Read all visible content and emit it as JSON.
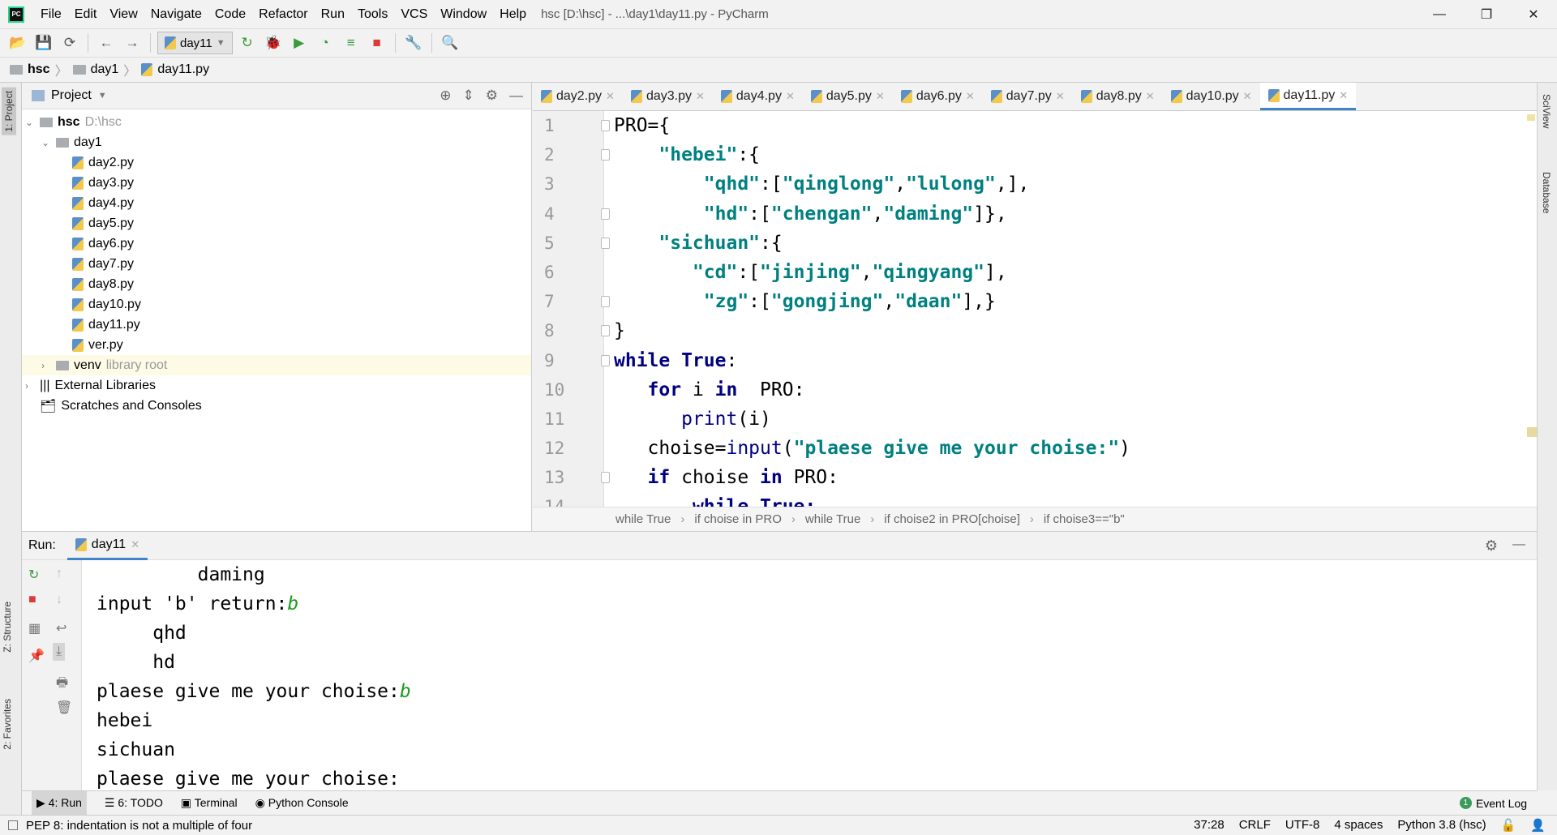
{
  "window": {
    "title": "hsc [D:\\hsc] - ...\\day1\\day11.py - PyCharm",
    "minimize": "—",
    "restore": "❐",
    "close": "✕"
  },
  "menu": [
    "File",
    "Edit",
    "View",
    "Navigate",
    "Code",
    "Refactor",
    "Run",
    "Tools",
    "VCS",
    "Window",
    "Help"
  ],
  "toolbar": {
    "run_config": "day11"
  },
  "navbar": [
    "hsc",
    "day1",
    "day11.py"
  ],
  "left_stripe": {
    "project": "1: Project",
    "structure": "Z: Structure",
    "favorites": "2: Favorites"
  },
  "right_stripe": {
    "sciview": "SciView",
    "database": "Database"
  },
  "project": {
    "title": "Project",
    "root": {
      "name": "hsc",
      "path": "D:\\hsc"
    },
    "folder": "day1",
    "files": [
      "day2.py",
      "day3.py",
      "day4.py",
      "day5.py",
      "day6.py",
      "day7.py",
      "day8.py",
      "day10.py",
      "day11.py",
      "ver.py"
    ],
    "venv": {
      "name": "venv",
      "note": "library root"
    },
    "external": "External Libraries",
    "scratches": "Scratches and Consoles"
  },
  "editor": {
    "tabs": [
      "day2.py",
      "day3.py",
      "day4.py",
      "day5.py",
      "day6.py",
      "day7.py",
      "day8.py",
      "day10.py",
      "day11.py"
    ],
    "active_tab": "day11.py",
    "lines": [
      [
        [
          "PRO={",
          "n"
        ]
      ],
      [
        [
          "    ",
          "n"
        ],
        [
          "\"hebei\"",
          "str"
        ],
        [
          ":{",
          "n"
        ]
      ],
      [
        [
          "        ",
          "n"
        ],
        [
          "\"qhd\"",
          "str"
        ],
        [
          ":[",
          "n"
        ],
        [
          "\"qinglong\"",
          "str"
        ],
        [
          ",",
          "n"
        ],
        [
          "\"lulong\"",
          "str"
        ],
        [
          ",],",
          "n"
        ]
      ],
      [
        [
          "        ",
          "n"
        ],
        [
          "\"hd\"",
          "str"
        ],
        [
          ":[",
          "n"
        ],
        [
          "\"chengan\"",
          "str"
        ],
        [
          ",",
          "n"
        ],
        [
          "\"daming\"",
          "str"
        ],
        [
          "]},",
          "n"
        ]
      ],
      [
        [
          "    ",
          "n"
        ],
        [
          "\"sichuan\"",
          "str"
        ],
        [
          ":{",
          "n"
        ]
      ],
      [
        [
          "       ",
          "n"
        ],
        [
          "\"cd\"",
          "str"
        ],
        [
          ":[",
          "n"
        ],
        [
          "\"jinjing\"",
          "str"
        ],
        [
          ",",
          "n"
        ],
        [
          "\"qingyang\"",
          "str"
        ],
        [
          "],",
          "n"
        ]
      ],
      [
        [
          "        ",
          "n"
        ],
        [
          "\"zg\"",
          "str"
        ],
        [
          ":[",
          "n"
        ],
        [
          "\"gongjing\"",
          "str"
        ],
        [
          ",",
          "n"
        ],
        [
          "\"daan\"",
          "str"
        ],
        [
          "],}",
          "n"
        ]
      ],
      [
        [
          "}",
          "n"
        ]
      ],
      [
        [
          "while True",
          "kw"
        ],
        [
          ":",
          "n"
        ]
      ],
      [
        [
          "   ",
          "n"
        ],
        [
          "for",
          "kw"
        ],
        [
          " i ",
          "n"
        ],
        [
          "in",
          "kw"
        ],
        [
          "  PRO:",
          "n"
        ]
      ],
      [
        [
          "      ",
          "n"
        ],
        [
          "print",
          "bi"
        ],
        [
          "(i)",
          "n"
        ]
      ],
      [
        [
          "   choise=",
          "n"
        ],
        [
          "input",
          "bi"
        ],
        [
          "(",
          "n"
        ],
        [
          "\"plaese give me your choise:\"",
          "str"
        ],
        [
          ")",
          "n"
        ]
      ],
      [
        [
          "   ",
          "n"
        ],
        [
          "if",
          "kw"
        ],
        [
          " choise ",
          "n"
        ],
        [
          "in",
          "kw"
        ],
        [
          " PRO:",
          "n"
        ]
      ],
      [
        [
          "       ",
          "n"
        ],
        [
          "while True:",
          "kw"
        ]
      ]
    ],
    "breadcrumbs": [
      "while True",
      "if choise in PRO",
      "while True",
      "if choise2 in PRO[choise]",
      "if choise3==\"b\""
    ]
  },
  "run": {
    "label": "Run:",
    "tab": "day11",
    "output": [
      [
        [
          "         daming",
          "n"
        ]
      ],
      [
        [
          "input 'b' return:",
          "n"
        ],
        [
          "b",
          "inp"
        ]
      ],
      [
        [
          "     qhd",
          "n"
        ]
      ],
      [
        [
          "     hd",
          "n"
        ]
      ],
      [
        [
          "plaese give me your choise:",
          "n"
        ],
        [
          "b",
          "inp"
        ]
      ],
      [
        [
          "hebei",
          "n"
        ]
      ],
      [
        [
          "sichuan",
          "n"
        ]
      ],
      [
        [
          "plaese give me your choise:",
          "n"
        ]
      ]
    ]
  },
  "bottom_tabs": [
    "4: Run",
    "6: TODO",
    "Terminal",
    "Python Console"
  ],
  "event_log": {
    "label": "Event Log",
    "count": "1"
  },
  "status": {
    "message": "PEP 8: indentation is not a multiple of four",
    "position": "37:28",
    "line_sep": "CRLF",
    "encoding": "UTF-8",
    "indent": "4 spaces",
    "interpreter": "Python 3.8 (hsc)"
  },
  "colors": {
    "keyword": "#000080",
    "string": "#008080",
    "user_input": "#1a9c1a",
    "accent": "#4083c9"
  }
}
